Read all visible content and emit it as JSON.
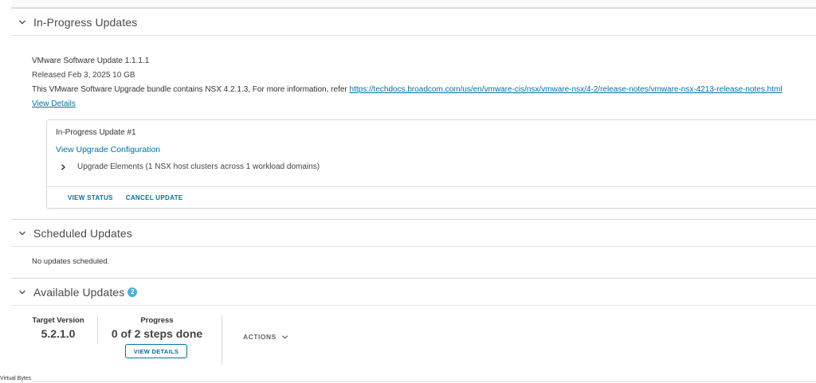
{
  "in_progress": {
    "title": "In-Progress Updates",
    "bundle_name": "VMware Software Update 1.1.1.1",
    "released": "Released Feb 3, 2025 10 GB",
    "description": "This VMware Software Upgrade bundle contains NSX 4.2.1.3, For more information, refer",
    "release_notes_url": "https://techdocs.broadcom.com/us/en/vmware-cis/nsx/vmware-nsx/4-2/release-notes/vmware-nsx-4213-release-notes.html",
    "view_details": "View Details",
    "card": {
      "title": "In-Progress Update #1",
      "config_link": "View Upgrade Configuration",
      "elements_label": "Upgrade Elements (1 NSX host clusters across 1 workload domains)",
      "view_status": "VIEW STATUS",
      "cancel_update": "CANCEL UPDATE"
    }
  },
  "scheduled": {
    "title": "Scheduled Updates",
    "empty_message": "No updates scheduled."
  },
  "available": {
    "title": "Available Updates",
    "count": "2",
    "target_version_label": "Target Version",
    "target_version_value": "5.2.1.0",
    "progress_label": "Progress",
    "progress_value": "0 of 2 steps done",
    "view_details_button": "VIEW DETAILS",
    "actions_label": "ACTIONS"
  },
  "watermark": "Virtual Bytes",
  "colors": {
    "link": "#0072a3",
    "badge": "#49afd9",
    "border": "#d8d8d8"
  },
  "icons": [
    "chevron-down-icon",
    "chevron-right-icon"
  ]
}
